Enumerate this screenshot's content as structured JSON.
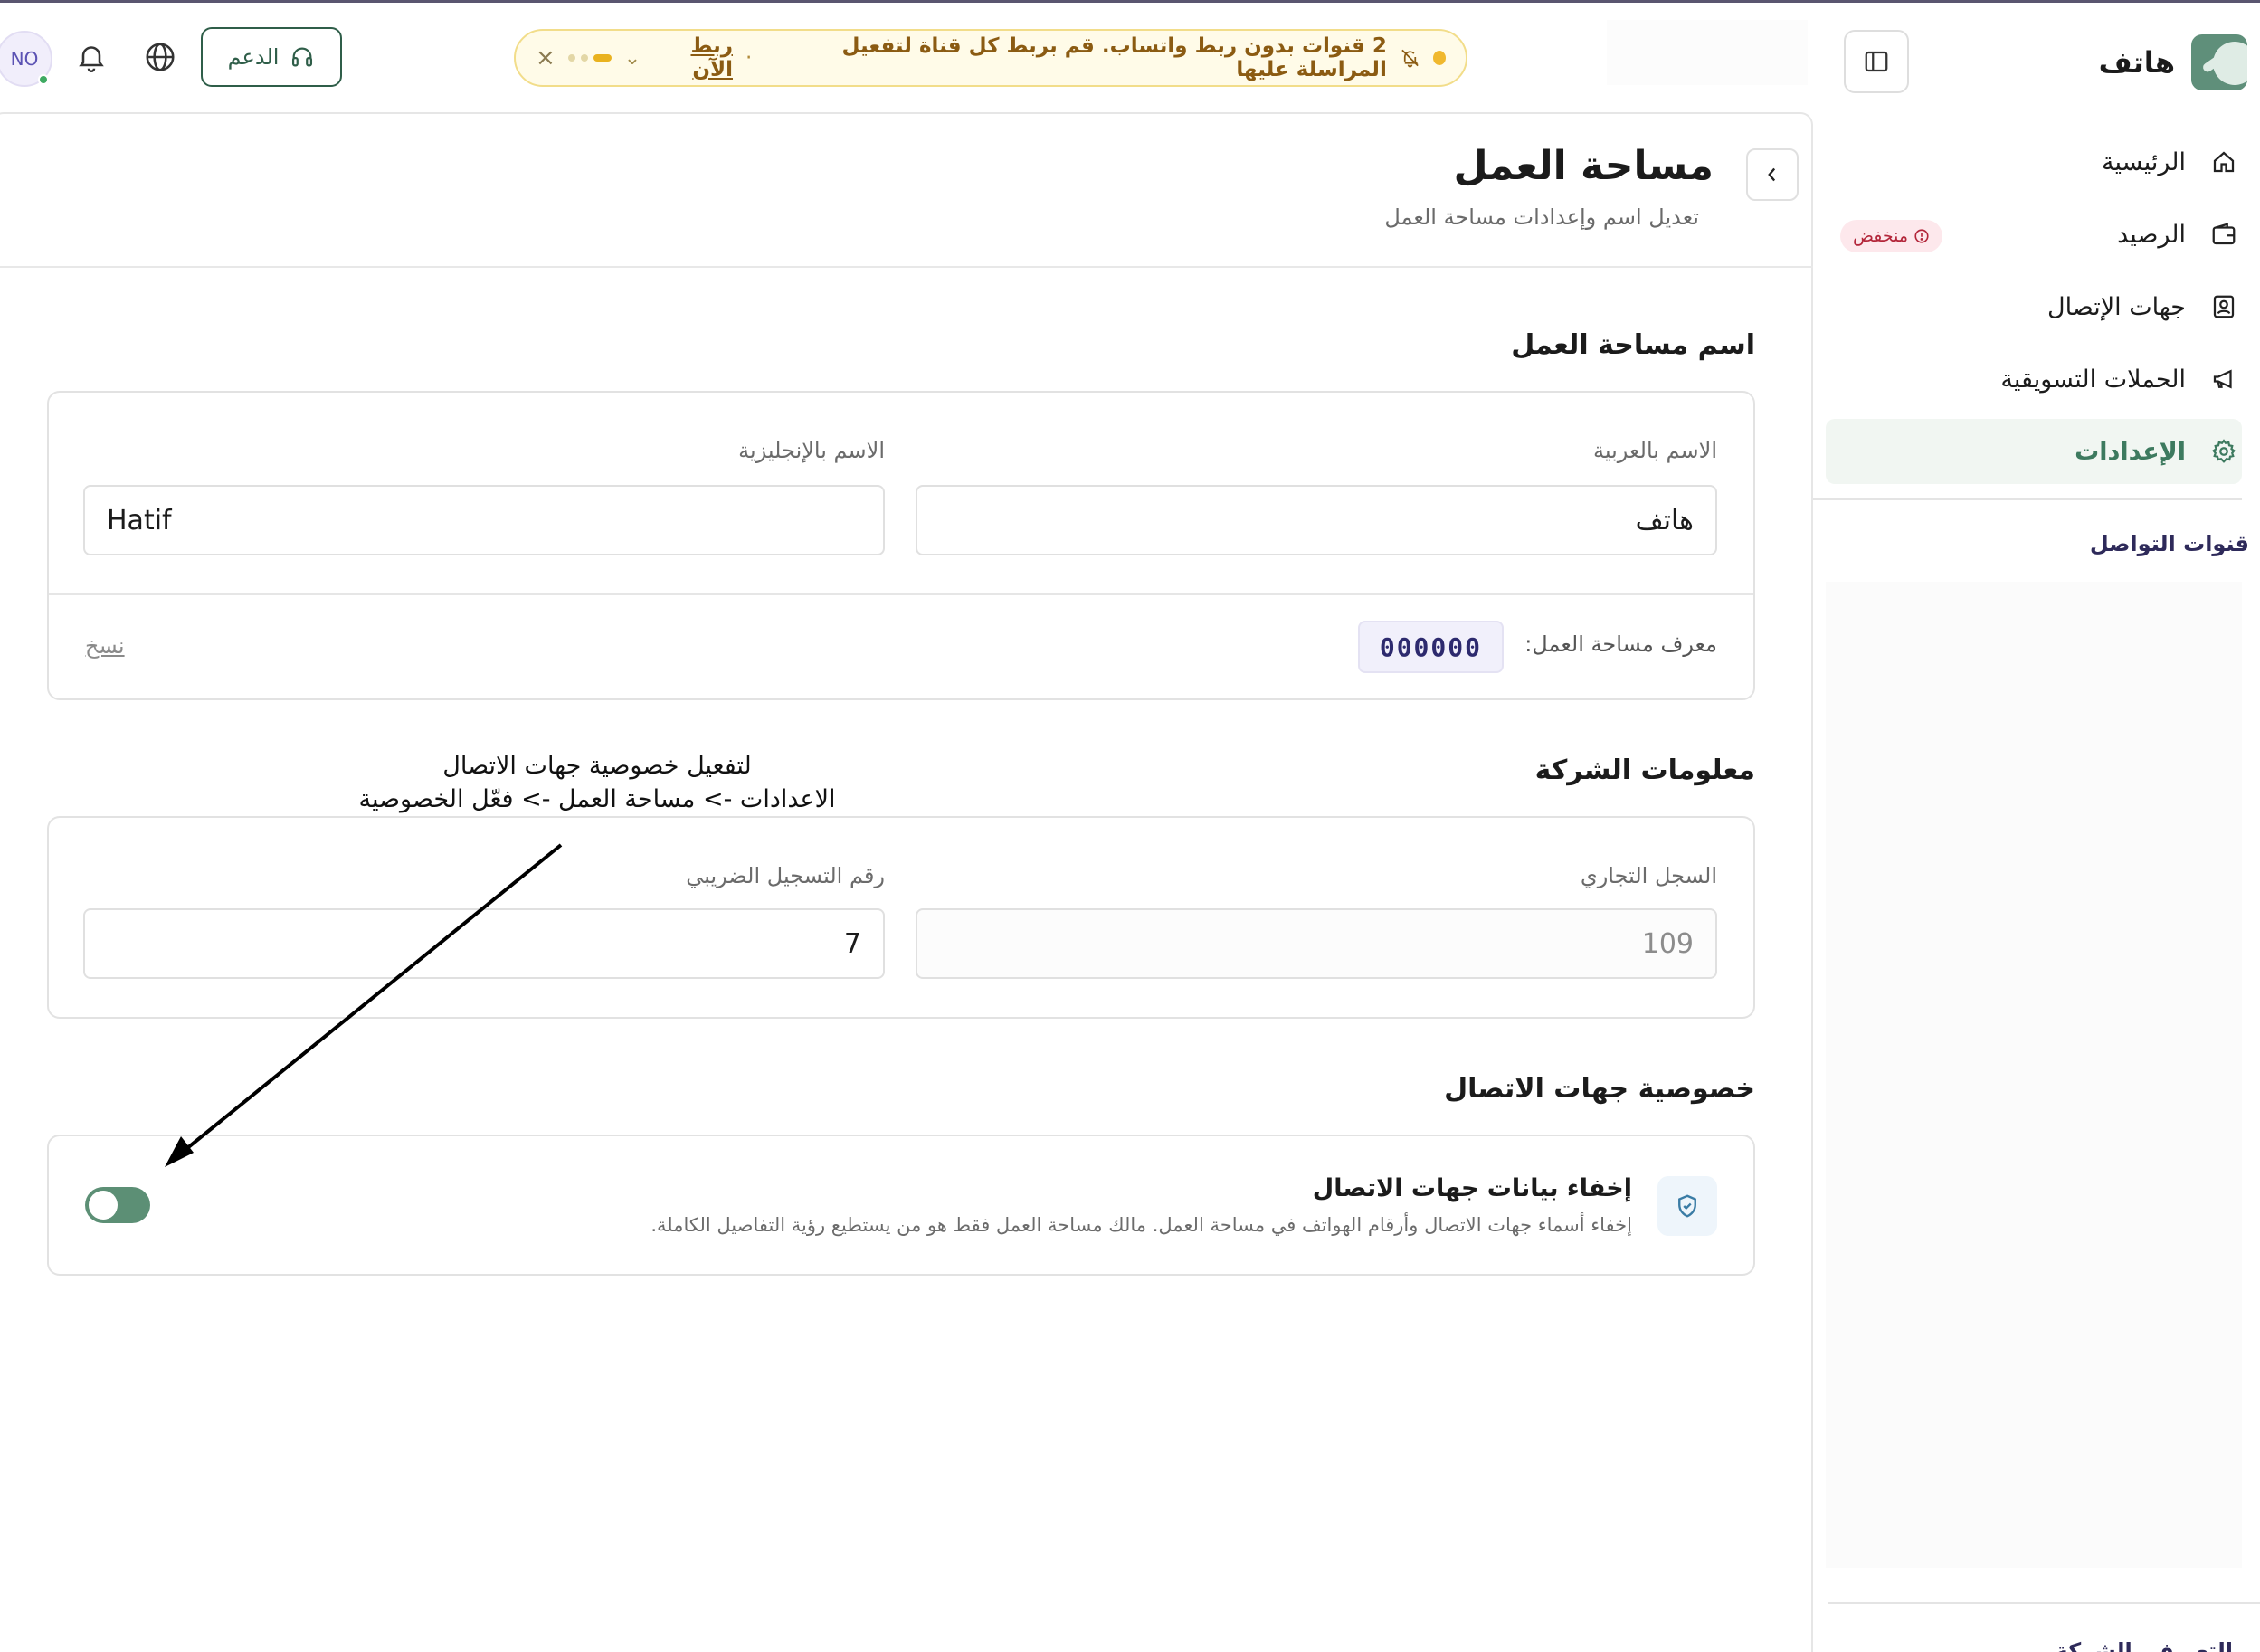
{
  "app": {
    "name": "هاتف"
  },
  "sidebar": {
    "items": [
      {
        "label": "الرئيسية",
        "icon": "home-icon"
      },
      {
        "label": "الرصيد",
        "icon": "wallet-icon",
        "badge": "منخفض"
      },
      {
        "label": "جهات الإتصال",
        "icon": "contact-icon"
      },
      {
        "label": "الحملات التسويقية",
        "icon": "megaphone-icon"
      },
      {
        "label": "الإعدادات",
        "icon": "gear-icon",
        "active": true
      }
    ],
    "section_title": "قنوات التواصل",
    "bottom_label": "التعريف بالشركة"
  },
  "banner": {
    "message": "2 قنوات بدون ربط واتساب. قم بربط كل قناة لتفعيل المراسلة عليها",
    "separator": "·",
    "link": "ربط الآن",
    "close": "×"
  },
  "topbar": {
    "support_label": "الدعم",
    "avatar_initials": "NO"
  },
  "page": {
    "title": "مساحة العمل",
    "subtitle": "تعديل اسم وإعدادات مساحة العمل"
  },
  "workspace_name": {
    "heading": "اسم مساحة العمل",
    "arabic_label": "الاسم بالعربية",
    "arabic_value": "هاتف",
    "english_label": "الاسم بالإنجليزية",
    "english_value": "Hatif",
    "id_label": "معرف مساحة العمل:",
    "id_value": "000000",
    "copy_label": "نسخ"
  },
  "company_info": {
    "heading": "معلومات الشركة",
    "cr_label": "السجل التجاري",
    "cr_value": "109",
    "tax_label": "رقم التسجيل الضريبي",
    "tax_value": "7"
  },
  "contact_privacy": {
    "heading": "خصوصية جهات الاتصال",
    "option_title": "إخفاء بيانات جهات الاتصال",
    "option_desc": "إخفاء أسماء جهات الاتصال وأرقام الهواتف في مساحة العمل. مالك مساحة العمل فقط هو من يستطيع رؤية التفاصيل الكاملة.",
    "enabled": false
  },
  "annotation": {
    "line1": "لتفعيل خصوصية جهات الاتصال",
    "line2": "الاعدادات -> مساحة العمل -> فعّل الخصوصية"
  },
  "colors": {
    "accent": "#3d7a5f",
    "toggle": "#5c8f75",
    "banner_bg": "#fffbe8",
    "badge_bg": "#fde8ec"
  }
}
